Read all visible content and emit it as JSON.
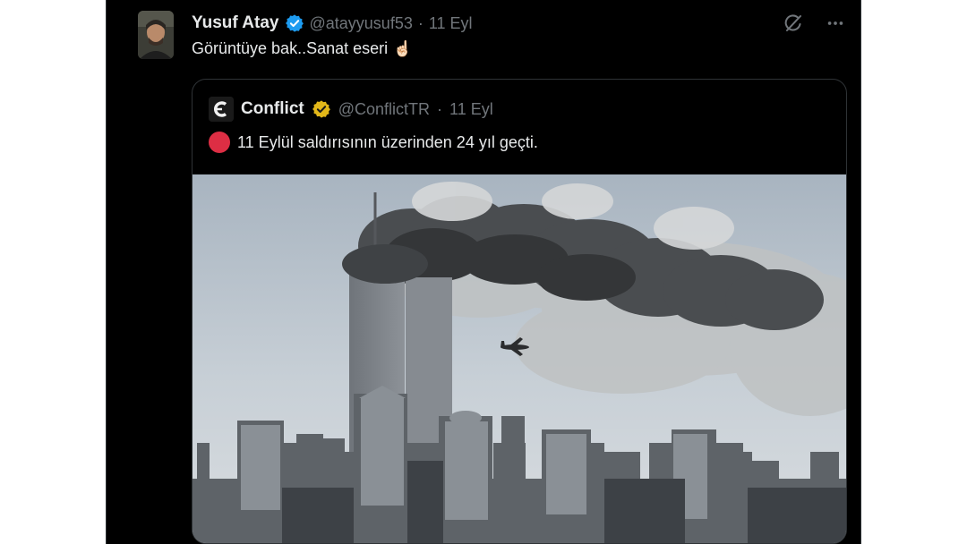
{
  "tweet": {
    "author_name": "Yusuf Atay",
    "handle": "@atayyusuf53",
    "separator": "·",
    "date": "11 Eyl",
    "text": "Görüntüye bak..Sanat eseri",
    "emoji": "☝🏻",
    "icons": [
      "grok-icon",
      "more-icon"
    ]
  },
  "quote": {
    "author_name": "Conflict",
    "handle": "@ConflictTR",
    "separator": "·",
    "date": "11 Eyl",
    "text": "11 Eylül saldırısının üzerinden 24 yıl geçti.",
    "status_emoji": "red-circle",
    "logo_letter": "C"
  },
  "colors": {
    "background": "#000000",
    "text": "#e7e9ea",
    "muted": "#71767b",
    "border": "#2f3336",
    "verified_blue": "#1d9bf0",
    "verified_gold": "#e2b719",
    "red_dot": "#dd2e44"
  }
}
